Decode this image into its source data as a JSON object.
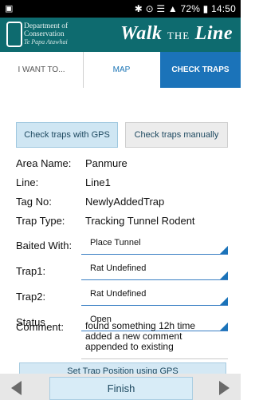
{
  "status_bar": {
    "left_icon": "screen-icon",
    "icons_text": "✱ ⊙ ☰ ▲ 72% ▮",
    "time": "14:50"
  },
  "app_header": {
    "logo": {
      "line1": "Department of",
      "line2": "Conservation",
      "line3": "Te Papa Atawhai"
    },
    "title_walk": "Walk",
    "title_the": "THE",
    "title_line": "Line"
  },
  "tabs": [
    {
      "label": "I WANT TO...",
      "active": false
    },
    {
      "label": "MAP",
      "active": false
    },
    {
      "label": "CHECK TRAPS",
      "active": true
    }
  ],
  "buttons": {
    "gps": "Check traps with GPS",
    "manual": "Check traps manually"
  },
  "fields": {
    "area_name": {
      "label": "Area Name:",
      "value": "Panmure"
    },
    "line": {
      "label": "Line:",
      "value": "Line1"
    },
    "tag_no": {
      "label": "Tag No:",
      "value": "NewlyAddedTrap"
    },
    "trap_type": {
      "label": "Trap Type:",
      "value": "Tracking Tunnel Rodent"
    },
    "baited_with": {
      "label": "Baited With:",
      "value": "Place Tunnel"
    },
    "trap1": {
      "label": "Trap1:",
      "value": "Rat Undefined"
    },
    "trap2": {
      "label": "Trap2:",
      "value": "Rat Undefined"
    },
    "status": {
      "label": "Status",
      "value": "Open"
    },
    "comment": {
      "label": "Comment:",
      "value": "found something 12h time added a new comment appended to existing"
    }
  },
  "partial_button": "Set Trap Position using GPS",
  "bottom": {
    "finish": "Finish"
  },
  "colors": {
    "header": "#0e6b6f",
    "accent": "#1b73b9"
  }
}
